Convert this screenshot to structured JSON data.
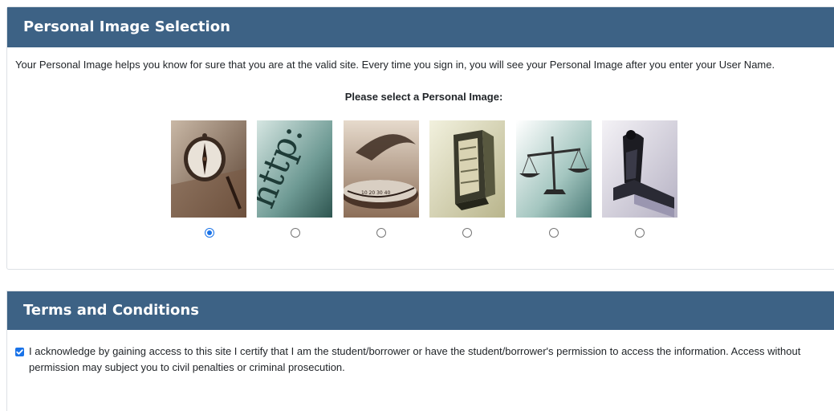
{
  "personal": {
    "title": "Personal Image Selection",
    "intro": "Your Personal Image helps you know for sure that you are at the valid site. Every time you sign in, you will see your Personal Image after you enter your User Name.",
    "select_label": "Please select a Personal Image:",
    "images": [
      {
        "icon": "compass-image",
        "selected": true
      },
      {
        "icon": "http-text-image",
        "selected": false
      },
      {
        "icon": "dial-image",
        "selected": false
      },
      {
        "icon": "safe-image",
        "selected": false
      },
      {
        "icon": "scales-image",
        "selected": false
      },
      {
        "icon": "stapler-image",
        "selected": false
      }
    ]
  },
  "terms": {
    "title": "Terms and Conditions",
    "checked": true,
    "acknowledgement": "I acknowledge by gaining access to this site I certify that I am the student/borrower or have the student/borrower's permission to access the information. Access without permission may subject you to civil penalties or criminal prosecution."
  },
  "colors": {
    "header_bg": "#3d6285",
    "accent": "#1a73e8"
  }
}
